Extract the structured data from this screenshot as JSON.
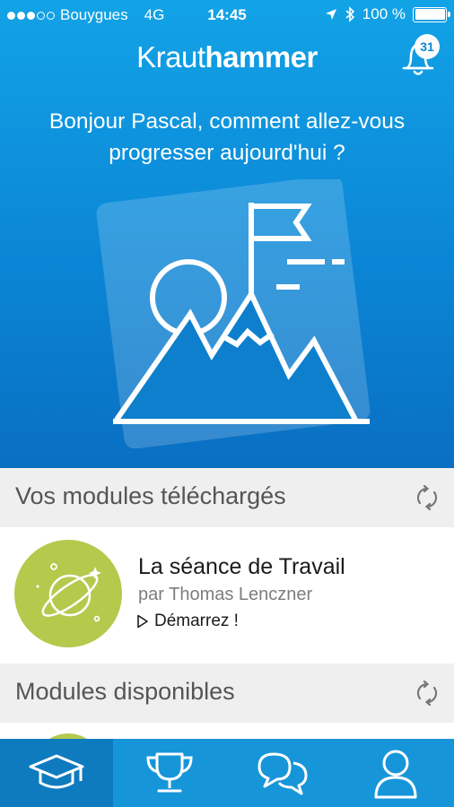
{
  "status_bar": {
    "carrier": "Bouygues",
    "network": "4G",
    "time": "14:45",
    "battery": "100 %"
  },
  "header": {
    "logo_light": "Kraut",
    "logo_bold": "hammer",
    "notification_count": "31"
  },
  "greeting": "Bonjour Pascal, comment allez-vous progresser aujourd'hui ?",
  "downloaded": {
    "title": "Vos modules téléchargés",
    "modules": [
      {
        "title": "La séance de Travail",
        "author": "par Thomas Lenczner",
        "action": "Démarrez !"
      }
    ]
  },
  "available": {
    "title": "Modules disponibles"
  },
  "colors": {
    "brand_blue": "#0b86d6",
    "tab_bar": "#1795d9",
    "module_green": "#b5c94d"
  },
  "tabs": [
    {
      "icon": "graduation-cap-icon",
      "active": true
    },
    {
      "icon": "trophy-icon",
      "active": false
    },
    {
      "icon": "chat-bubbles-icon",
      "active": false
    },
    {
      "icon": "profile-icon",
      "active": false
    }
  ]
}
